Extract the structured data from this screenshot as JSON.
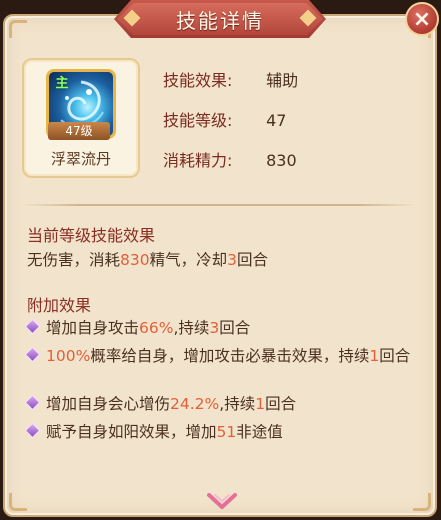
{
  "title": "技能详情",
  "close_label": "×",
  "skill": {
    "badge": "主",
    "level_badge": "47级",
    "name": "浮翠流丹"
  },
  "stats": [
    {
      "label": "技能效果:",
      "value": "辅助"
    },
    {
      "label": "技能等级:",
      "value": "47"
    },
    {
      "label": "消耗精力:",
      "value": "830"
    }
  ],
  "current_effect": {
    "title": "当前等级技能效果",
    "parts": [
      "无伤害，消耗",
      "830",
      "精气，冷却",
      "3",
      "回合"
    ]
  },
  "extra_effect": {
    "title": "附加效果",
    "items": [
      {
        "parts": [
          "增加自身攻击",
          "66%",
          ",持续",
          "3",
          "回合"
        ]
      },
      {
        "parts": [
          "",
          "100%",
          "概率给自身，增加攻击必暴击效果，持续",
          "1",
          "回合"
        ]
      },
      {
        "parts": [
          "增加自身会心增伤",
          "24.2%",
          ",持续",
          "1",
          "回合"
        ]
      },
      {
        "parts": [
          "赋予自身如阳效果，增加",
          "51",
          "非途值",
          "",
          ""
        ]
      }
    ]
  },
  "colors": {
    "highlight": "#e2603a",
    "title_banner": "#b2463c",
    "panel": "#f2e4cc"
  },
  "icons": [
    "close-icon",
    "skill-icon",
    "diamond-bullet-icon",
    "scroll-down-icon"
  ]
}
